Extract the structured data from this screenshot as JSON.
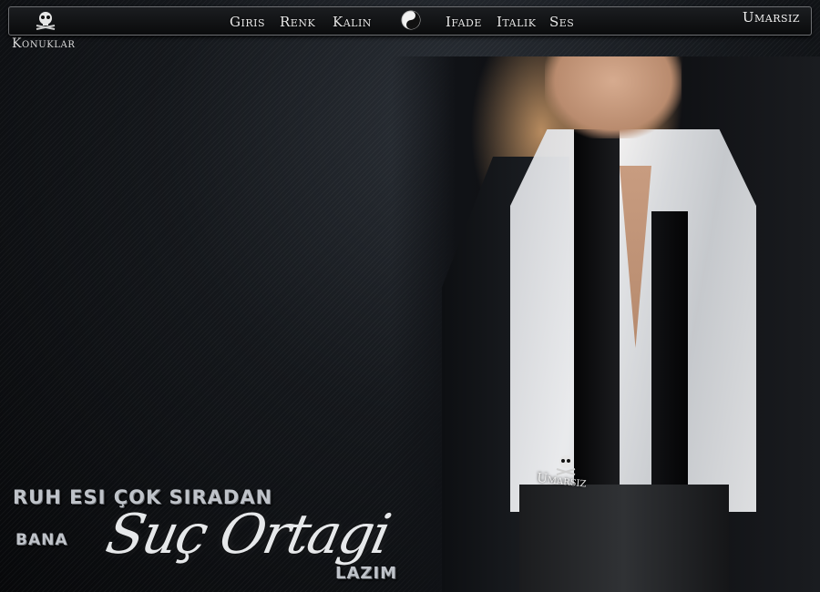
{
  "topbar": {
    "nav": {
      "giris": "Giris",
      "renk": "Renk",
      "kalin": "Kalin",
      "ifade": "Ifade",
      "italik": "Italik",
      "ses": "Ses"
    },
    "brand": "Umarsiz",
    "icons": {
      "left": "skull-crossbones-icon",
      "center": "yin-yang-icon"
    }
  },
  "guests_label": "Konuklar",
  "hero": {
    "belt_brand": "Umarsiz",
    "belt_icon": "skull-crossbones-icon"
  },
  "slogan": {
    "line1": "RUH ESI ÇOK SIRADAN",
    "bana": "BANA",
    "script": "Suç Ortagi",
    "lazim": "LAZIM"
  }
}
